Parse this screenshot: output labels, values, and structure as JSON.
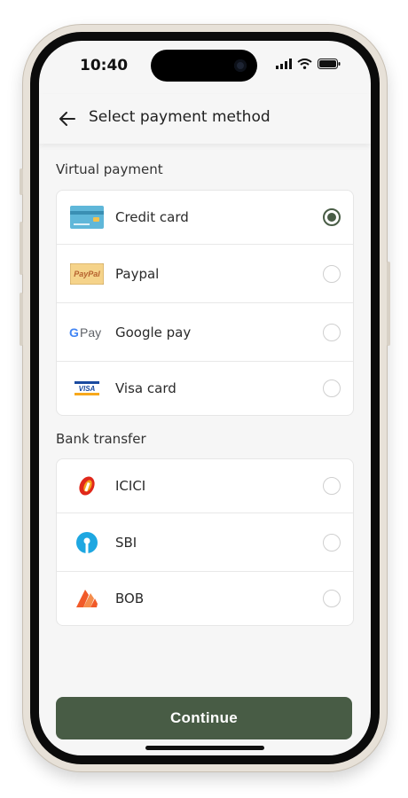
{
  "status_bar": {
    "time": "10:40"
  },
  "header": {
    "title": "Select payment method"
  },
  "sections": {
    "virtual": {
      "title": "Virtual payment",
      "items": [
        {
          "label": "Credit card",
          "icon": "credit-card-icon",
          "selected": true
        },
        {
          "label": "Paypal",
          "icon": "paypal-icon",
          "selected": false
        },
        {
          "label": "Google pay",
          "icon": "google-pay-icon",
          "selected": false
        },
        {
          "label": "Visa card",
          "icon": "visa-icon",
          "selected": false
        }
      ]
    },
    "bank": {
      "title": "Bank transfer",
      "items": [
        {
          "label": "ICICI",
          "icon": "icici-icon",
          "selected": false
        },
        {
          "label": "SBI",
          "icon": "sbi-icon",
          "selected": false
        },
        {
          "label": "BOB",
          "icon": "bob-icon",
          "selected": false
        }
      ]
    }
  },
  "actions": {
    "continue_label": "Continue"
  },
  "logo_text": {
    "paypal": "PayPal",
    "gpay": "Pay",
    "visa": "VISA"
  },
  "colors": {
    "accent": "#485c45",
    "background": "#f6f6f6"
  }
}
